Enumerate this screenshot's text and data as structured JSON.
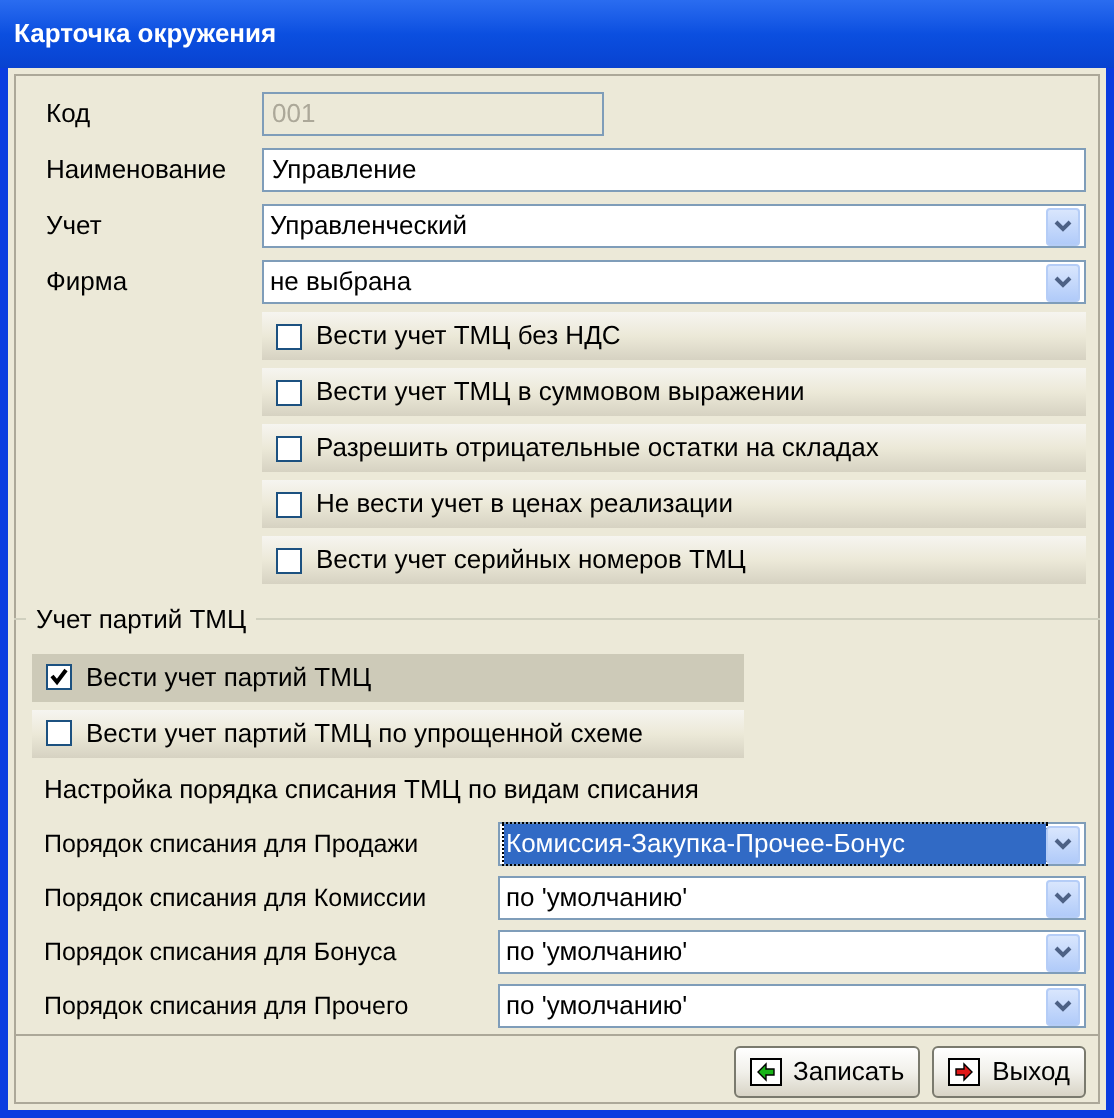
{
  "window": {
    "title": "Карточка окружения"
  },
  "fields": [
    {
      "label": "Код",
      "kind": "text",
      "value": "001",
      "disabled": true
    },
    {
      "label": "Наименование",
      "kind": "text",
      "value": "Управление",
      "disabled": false
    },
    {
      "label": "Учет",
      "kind": "combo",
      "value": "Управленческий"
    },
    {
      "label": "Фирма",
      "kind": "combo",
      "value": "не выбрана"
    }
  ],
  "options": [
    {
      "label": "Вести учет ТМЦ без НДС",
      "checked": false
    },
    {
      "label": "Вести учет ТМЦ в суммовом выражении",
      "checked": false
    },
    {
      "label": "Разрешить отрицательные остатки на складах",
      "checked": false
    },
    {
      "label": "Не вести учет в ценах реализации",
      "checked": false
    },
    {
      "label": "Вести учет серийных номеров ТМЦ",
      "checked": false
    }
  ],
  "batches": {
    "title": "Учет партий ТМЦ",
    "options": [
      {
        "label": "Вести учет партий ТМЦ",
        "checked": true,
        "selected": true
      },
      {
        "label": "Вести учет партий ТМЦ по упрощенной схеме",
        "checked": false,
        "selected": false
      }
    ],
    "subtitle": "Настройка порядка списания ТМЦ по видам списания",
    "orders": [
      {
        "label": "Порядок списания для Продажи",
        "value": "Комиссия-Закупка-Прочее-Бонус",
        "selected": true
      },
      {
        "label": "Порядок списания для Комиссии",
        "value": "по 'умолчанию'",
        "selected": false
      },
      {
        "label": "Порядок списания для Бонуса",
        "value": "по 'умолчанию'",
        "selected": false
      },
      {
        "label": "Порядок списания для Прочего",
        "value": "по 'умолчанию'",
        "selected": false
      }
    ]
  },
  "buttons": [
    {
      "label": "Записать",
      "kind": "save"
    },
    {
      "label": "Выход",
      "kind": "exit"
    }
  ]
}
